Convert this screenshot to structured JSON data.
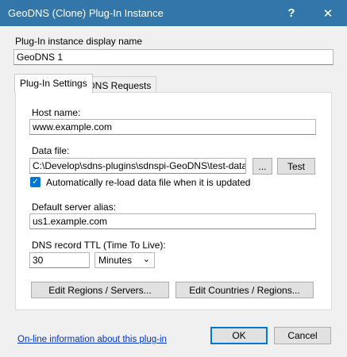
{
  "window": {
    "title": "GeoDNS (Clone) Plug-In Instance",
    "help_glyph": "?",
    "close_glyph": "✕"
  },
  "instance_name": {
    "label": "Plug-In instance display name",
    "value": "GeoDNS 1"
  },
  "tabs": [
    {
      "label": "Plug-In Settings",
      "active": true
    },
    {
      "label": "DNS Requests",
      "active": false
    }
  ],
  "settings": {
    "host_name_label": "Host name:",
    "host_name_value": "www.example.com",
    "data_file_label": "Data file:",
    "data_file_value": "C:\\Develop\\sdns-plugins\\sdnspi-GeoDNS\\test-data\\dbip",
    "browse_label": "...",
    "test_label": "Test",
    "reload_checkbox_label": "Automatically re-load data file when it is updated",
    "reload_checked": true,
    "default_alias_label": "Default server alias:",
    "default_alias_value": "us1.example.com",
    "ttl_label": "DNS record TTL (Time To Live):",
    "ttl_value": "30",
    "ttl_unit": "Minutes",
    "edit_regions_label": "Edit Regions / Servers...",
    "edit_countries_label": "Edit Countries / Regions..."
  },
  "footer": {
    "info_link": "On-line information about this plug-in",
    "ok_label": "OK",
    "cancel_label": "Cancel"
  },
  "colors": {
    "titlebar": "#3377aa",
    "accent": "#0078d7",
    "link": "#0033cc"
  }
}
